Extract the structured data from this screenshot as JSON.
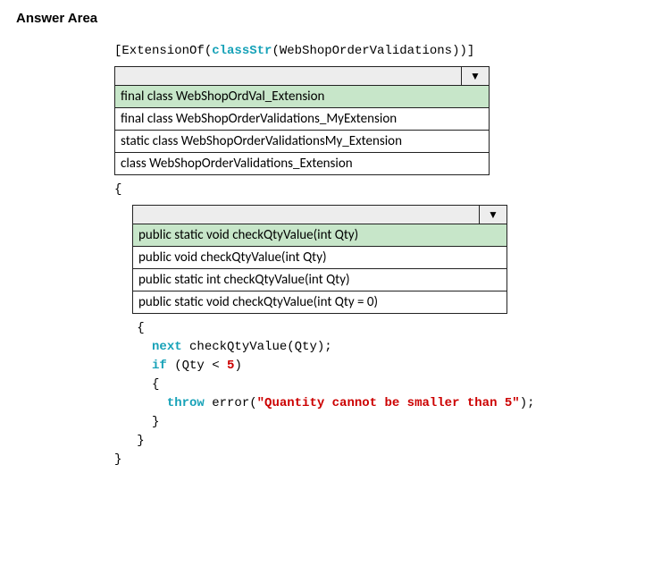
{
  "heading": "Answer Area",
  "attribute": {
    "open": "[ExtensionOf(",
    "classStr": "classStr",
    "mid": "(WebShopOrderValidations))]"
  },
  "dropdown1": {
    "options": [
      "final class WebShopOrdVal_Extension",
      "final class WebShopOrderValidations_MyExtension",
      "static class WebShopOrderValidationsMy_Extension",
      "class WebShopOrderValidations_Extension"
    ]
  },
  "brace_open1": "{",
  "dropdown2": {
    "options": [
      "public static void checkQtyValue(int Qty)",
      "public void checkQtyValue(int Qty)",
      "public static int checkQtyValue(int Qty)",
      "public static void checkQtyValue(int Qty = 0)"
    ]
  },
  "method_body": {
    "brace_open": "   {",
    "next_kw": "next",
    "next_call": " checkQtyValue(Qty);",
    "if_kw": "if",
    "if_cond_open": " (Qty < ",
    "if_num": "5",
    "if_cond_close": ")",
    "inner_brace_open": "     {",
    "throw_kw": "throw",
    "error_word": " error(",
    "error_str": "\"Quantity cannot be smaller than 5\"",
    "error_close": ");",
    "inner_brace_close": "     }",
    "brace_close": "   }"
  },
  "brace_close1": "}"
}
